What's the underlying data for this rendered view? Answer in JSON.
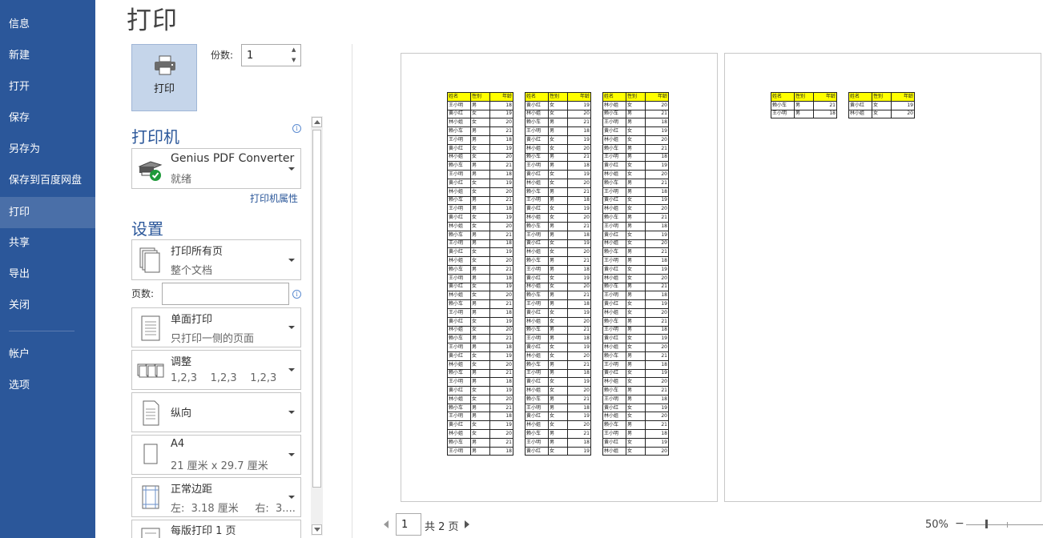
{
  "sidebar": {
    "items": [
      {
        "label": "信息"
      },
      {
        "label": "新建"
      },
      {
        "label": "打开"
      },
      {
        "label": "保存"
      },
      {
        "label": "另存为"
      },
      {
        "label": "保存到百度网盘"
      },
      {
        "label": "打印",
        "active": true
      },
      {
        "label": "共享"
      },
      {
        "label": "导出"
      },
      {
        "label": "关闭"
      },
      {
        "label": "帐户"
      },
      {
        "label": "选项"
      }
    ],
    "background": "#2b579a"
  },
  "page_title": "打印",
  "print_button": {
    "label": "打印",
    "icon": "printer-icon"
  },
  "copies": {
    "label": "份数:",
    "value": "1"
  },
  "printer": {
    "section_title": "打印机",
    "name": "Genius PDF Converter",
    "status": "就绪",
    "properties_link": "打印机属性",
    "icon": "printer-ready-icon"
  },
  "settings": {
    "section_title": "设置",
    "range": {
      "main": "打印所有页",
      "sub": "整个文档"
    },
    "pages_label": "页数:",
    "pages_value": "",
    "sides": {
      "main": "单面打印",
      "sub": "只打印一侧的页面"
    },
    "collate": {
      "main": "调整",
      "sub": "1,2,3    1,2,3    1,2,3"
    },
    "orientation": {
      "main": "纵向"
    },
    "paper": {
      "main": "A4",
      "sub": "21 厘米 x 29.7 厘米"
    },
    "margins": {
      "main": "正常边距",
      "sub": "左:  3.18 厘米     右:  3...."
    },
    "pages_per_sheet": {
      "main": "每版打印 1 页"
    }
  },
  "preview": {
    "table_header": [
      "姓名",
      "性别",
      "年龄"
    ],
    "page1_columns": [
      [
        [
          "王小明",
          "男",
          "18"
        ],
        [
          "黄小红",
          "女",
          "19"
        ],
        [
          "林小姐",
          "女",
          "20"
        ],
        [
          "赖小车",
          "男",
          "21"
        ],
        [
          "王小明",
          "男",
          "18"
        ],
        [
          "黄小红",
          "女",
          "19"
        ],
        [
          "林小姐",
          "女",
          "20"
        ],
        [
          "赖小车",
          "男",
          "21"
        ],
        [
          "王小明",
          "男",
          "18"
        ],
        [
          "黄小红",
          "女",
          "19"
        ],
        [
          "林小姐",
          "女",
          "20"
        ],
        [
          "赖小车",
          "男",
          "21"
        ],
        [
          "王小明",
          "男",
          "18"
        ],
        [
          "黄小红",
          "女",
          "19"
        ],
        [
          "林小姐",
          "女",
          "20"
        ],
        [
          "赖小车",
          "男",
          "21"
        ],
        [
          "王小明",
          "男",
          "18"
        ],
        [
          "黄小红",
          "女",
          "19"
        ],
        [
          "林小姐",
          "女",
          "20"
        ],
        [
          "赖小车",
          "男",
          "21"
        ],
        [
          "王小明",
          "男",
          "18"
        ],
        [
          "黄小红",
          "女",
          "19"
        ],
        [
          "林小姐",
          "女",
          "20"
        ],
        [
          "赖小车",
          "男",
          "21"
        ],
        [
          "王小明",
          "男",
          "18"
        ],
        [
          "黄小红",
          "女",
          "19"
        ],
        [
          "林小姐",
          "女",
          "20"
        ],
        [
          "赖小车",
          "男",
          "21"
        ],
        [
          "王小明",
          "男",
          "18"
        ],
        [
          "黄小红",
          "女",
          "19"
        ],
        [
          "林小姐",
          "女",
          "20"
        ],
        [
          "赖小车",
          "男",
          "21"
        ],
        [
          "王小明",
          "男",
          "18"
        ],
        [
          "黄小红",
          "女",
          "19"
        ],
        [
          "林小姐",
          "女",
          "20"
        ],
        [
          "赖小车",
          "男",
          "21"
        ],
        [
          "王小明",
          "男",
          "18"
        ],
        [
          "黄小红",
          "女",
          "19"
        ],
        [
          "林小姐",
          "女",
          "20"
        ],
        [
          "赖小车",
          "男",
          "21"
        ],
        [
          "王小明",
          "男",
          "18"
        ]
      ],
      [
        [
          "黄小红",
          "女",
          "19"
        ],
        [
          "林小姐",
          "女",
          "20"
        ],
        [
          "赖小车",
          "男",
          "21"
        ],
        [
          "王小明",
          "男",
          "18"
        ],
        [
          "黄小红",
          "女",
          "19"
        ],
        [
          "林小姐",
          "女",
          "20"
        ],
        [
          "赖小车",
          "男",
          "21"
        ],
        [
          "王小明",
          "男",
          "18"
        ],
        [
          "黄小红",
          "女",
          "19"
        ],
        [
          "林小姐",
          "女",
          "20"
        ],
        [
          "赖小车",
          "男",
          "21"
        ],
        [
          "王小明",
          "男",
          "18"
        ],
        [
          "黄小红",
          "女",
          "19"
        ],
        [
          "林小姐",
          "女",
          "20"
        ],
        [
          "赖小车",
          "男",
          "21"
        ],
        [
          "王小明",
          "男",
          "18"
        ],
        [
          "黄小红",
          "女",
          "19"
        ],
        [
          "林小姐",
          "女",
          "20"
        ],
        [
          "赖小车",
          "男",
          "21"
        ],
        [
          "王小明",
          "男",
          "18"
        ],
        [
          "黄小红",
          "女",
          "19"
        ],
        [
          "林小姐",
          "女",
          "20"
        ],
        [
          "赖小车",
          "男",
          "21"
        ],
        [
          "王小明",
          "男",
          "18"
        ],
        [
          "黄小红",
          "女",
          "19"
        ],
        [
          "林小姐",
          "女",
          "20"
        ],
        [
          "赖小车",
          "男",
          "21"
        ],
        [
          "王小明",
          "男",
          "18"
        ],
        [
          "黄小红",
          "女",
          "19"
        ],
        [
          "林小姐",
          "女",
          "20"
        ],
        [
          "赖小车",
          "男",
          "21"
        ],
        [
          "王小明",
          "男",
          "18"
        ],
        [
          "黄小红",
          "女",
          "19"
        ],
        [
          "林小姐",
          "女",
          "20"
        ],
        [
          "赖小车",
          "男",
          "21"
        ],
        [
          "王小明",
          "男",
          "18"
        ],
        [
          "黄小红",
          "女",
          "19"
        ],
        [
          "林小姐",
          "女",
          "20"
        ],
        [
          "赖小车",
          "男",
          "21"
        ],
        [
          "王小明",
          "男",
          "18"
        ],
        [
          "黄小红",
          "女",
          "19"
        ]
      ],
      [
        [
          "林小姐",
          "女",
          "20"
        ],
        [
          "赖小车",
          "男",
          "21"
        ],
        [
          "王小明",
          "男",
          "18"
        ],
        [
          "黄小红",
          "女",
          "19"
        ],
        [
          "林小姐",
          "女",
          "20"
        ],
        [
          "赖小车",
          "男",
          "21"
        ],
        [
          "王小明",
          "男",
          "18"
        ],
        [
          "黄小红",
          "女",
          "19"
        ],
        [
          "林小姐",
          "女",
          "20"
        ],
        [
          "赖小车",
          "男",
          "21"
        ],
        [
          "王小明",
          "男",
          "18"
        ],
        [
          "黄小红",
          "女",
          "19"
        ],
        [
          "林小姐",
          "女",
          "20"
        ],
        [
          "赖小车",
          "男",
          "21"
        ],
        [
          "王小明",
          "男",
          "18"
        ],
        [
          "黄小红",
          "女",
          "19"
        ],
        [
          "林小姐",
          "女",
          "20"
        ],
        [
          "赖小车",
          "男",
          "21"
        ],
        [
          "王小明",
          "男",
          "18"
        ],
        [
          "黄小红",
          "女",
          "19"
        ],
        [
          "林小姐",
          "女",
          "20"
        ],
        [
          "赖小车",
          "男",
          "21"
        ],
        [
          "王小明",
          "男",
          "18"
        ],
        [
          "黄小红",
          "女",
          "19"
        ],
        [
          "林小姐",
          "女",
          "20"
        ],
        [
          "赖小车",
          "男",
          "21"
        ],
        [
          "王小明",
          "男",
          "18"
        ],
        [
          "黄小红",
          "女",
          "19"
        ],
        [
          "林小姐",
          "女",
          "20"
        ],
        [
          "赖小车",
          "男",
          "21"
        ],
        [
          "王小明",
          "男",
          "18"
        ],
        [
          "黄小红",
          "女",
          "19"
        ],
        [
          "林小姐",
          "女",
          "20"
        ],
        [
          "赖小车",
          "男",
          "21"
        ],
        [
          "王小明",
          "男",
          "18"
        ],
        [
          "黄小红",
          "女",
          "19"
        ],
        [
          "林小姐",
          "女",
          "20"
        ],
        [
          "赖小车",
          "男",
          "21"
        ],
        [
          "王小明",
          "男",
          "18"
        ],
        [
          "黄小红",
          "女",
          "19"
        ],
        [
          "林小姐",
          "女",
          "20"
        ]
      ]
    ],
    "page2_columns": [
      [
        [
          "赖小车",
          "男",
          "21"
        ],
        [
          "王小明",
          "男",
          "18"
        ]
      ],
      [
        [
          "黄小红",
          "女",
          "19"
        ],
        [
          "林小姐",
          "女",
          "20"
        ]
      ]
    ],
    "header_color": "#ffff00"
  },
  "page_nav": {
    "current": "1",
    "total_text": "共 2 页"
  },
  "zoom": {
    "level": "50%",
    "minus": "−",
    "value": 0.5
  }
}
